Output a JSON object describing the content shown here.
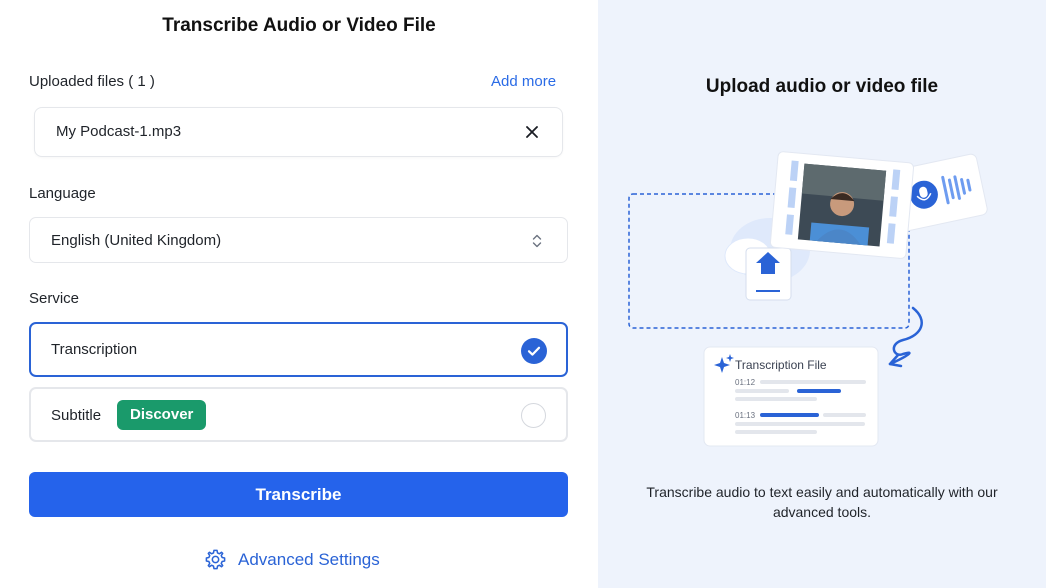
{
  "form": {
    "title": "Transcribe Audio or Video File",
    "uploaded_label": "Uploaded files ( 1 )",
    "add_more": "Add more",
    "file_name": "My Podcast-1.mp3",
    "language_label": "Language",
    "language_value": "English (United Kingdom)",
    "service_label": "Service",
    "services": [
      {
        "label": "Transcription",
        "selected": true
      },
      {
        "label": "Subtitle",
        "badge": "Discover",
        "selected": false
      }
    ],
    "submit_label": "Transcribe",
    "advanced_label": "Advanced Settings"
  },
  "promo": {
    "title": "Upload audio or video file",
    "card_title": "Transcription File",
    "timestamps": [
      "01:12",
      "01:13"
    ],
    "description": "Transcribe audio to text easily and automatically with our advanced tools."
  },
  "colors": {
    "accent": "#2563eb",
    "badge": "#1a9a6b",
    "panel_bg": "#eef3fc"
  },
  "icons": [
    "close-icon",
    "chevron-updown-icon",
    "check-icon",
    "gear-icon",
    "upload-icon",
    "microphone-icon",
    "sparkle-icon"
  ]
}
